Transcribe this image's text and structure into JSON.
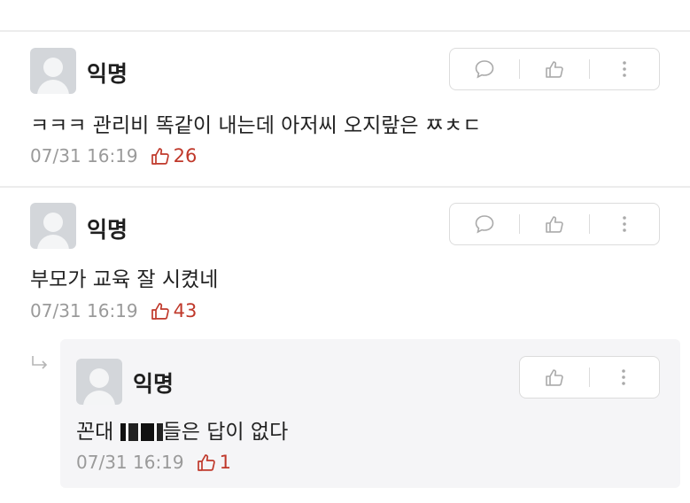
{
  "comments": [
    {
      "author": "익명",
      "text": "ㅋㅋㅋ 관리비 똑같이 내는데 아저씨 오지랖은 ㅉㅊㄷ",
      "timestamp": "07/31 16:19",
      "likes": "26",
      "icons": [
        "comment-icon",
        "thumbs-up-icon",
        "more-icon"
      ]
    },
    {
      "author": "익명",
      "text": "부모가 교육 잘 시켰네",
      "timestamp": "07/31 16:19",
      "likes": "43",
      "icons": [
        "comment-icon",
        "thumbs-up-icon",
        "more-icon"
      ]
    }
  ],
  "reply": {
    "author": "익명",
    "text_before": "꼰대 ",
    "text_after": "들은 답이 없다",
    "timestamp": "07/31 16:19",
    "likes": "1",
    "icons": [
      "reply-arrow-icon",
      "thumbs-up-icon",
      "more-icon"
    ]
  },
  "colors": {
    "like_count": "#c0392b",
    "meta_gray": "#9a9a9a",
    "reply_bg": "#f5f5f7"
  }
}
